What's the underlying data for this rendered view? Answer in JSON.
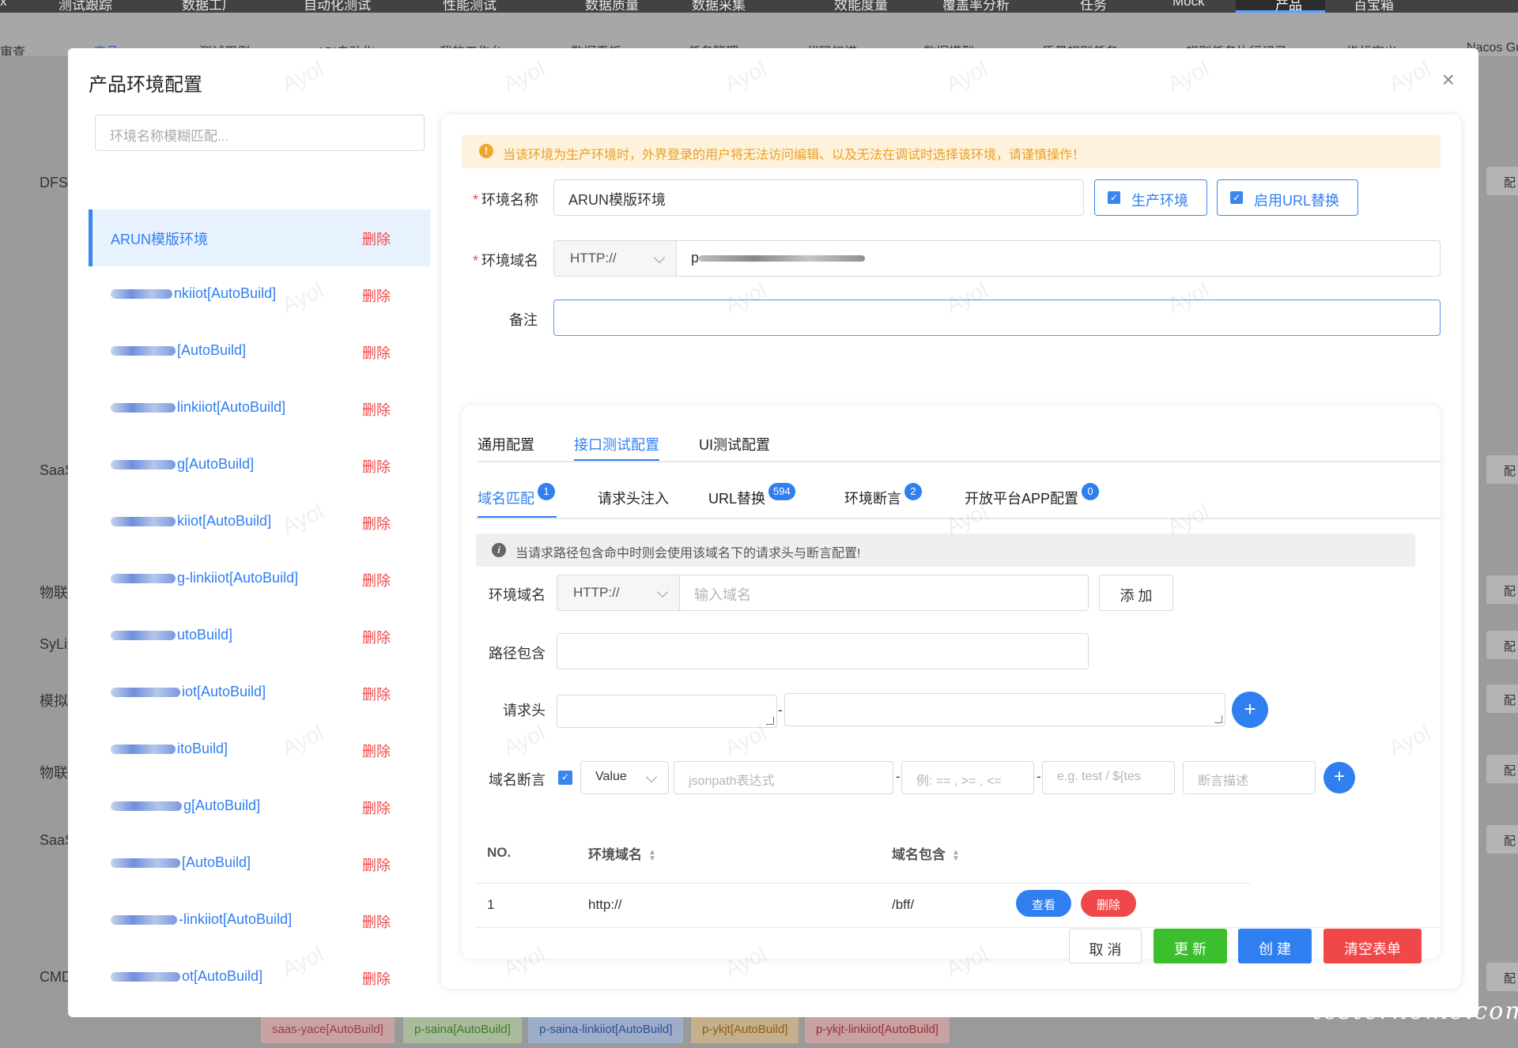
{
  "background": {
    "top_menu": [
      "测试跟踪",
      "数据工厂",
      "自动化测试",
      "性能测试",
      "数据质量",
      "数据采集",
      "效能度量",
      "覆盖率分析",
      "任务",
      "Mock",
      "产品",
      "百宝箱"
    ],
    "sub_tabs": [
      "审查",
      "产品",
      "测试用例",
      "API自动化",
      "我的工作台",
      "数据看板",
      "任务管理",
      "代码扫描",
      "数据模型",
      "质量规则任务",
      "规则任务执行记录",
      "指标定义",
      "Nacos Gu"
    ],
    "left_labels": [
      "DFS",
      "SaaS",
      "物联",
      "SyLi",
      "模拟",
      "物联",
      "SaaS",
      "CMD"
    ],
    "right_button_label": "配",
    "bottom_tags": [
      "saas-yace[AutoBuild]",
      "p-saina[AutoBuild]",
      "p-saina-linkiiot[AutoBuild]",
      "p-ykjt[AutoBuild]",
      "p-ykjt-linkiiot[AutoBuild]"
    ],
    "watermark_text": "Ayol",
    "corner_watermark": "testerhome.com"
  },
  "modal": {
    "title": "产品环境配置",
    "close_icon": "×",
    "search_placeholder": "环境名称模糊匹配...",
    "delete_label": "删除",
    "env_items": [
      {
        "name": "ARUN模版环境",
        "blur": 0
      },
      {
        "name": "nkiiot[AutoBuild]",
        "blur": 78
      },
      {
        "name": "[AutoBuild]",
        "blur": 82
      },
      {
        "name": "linkiiot[AutoBuild]",
        "blur": 82
      },
      {
        "name": "g[AutoBuild]",
        "blur": 82
      },
      {
        "name": "kiiot[AutoBuild]",
        "blur": 82
      },
      {
        "name": "g-linkiiot[AutoBuild]",
        "blur": 82
      },
      {
        "name": "utoBuild]",
        "blur": 82
      },
      {
        "name": "iot[AutoBuild]",
        "blur": 88
      },
      {
        "name": "itoBuild]",
        "blur": 82
      },
      {
        "name": "g[AutoBuild]",
        "blur": 90
      },
      {
        "name": "[AutoBuild]",
        "blur": 88
      },
      {
        "name": "-linkiiot[AutoBuild]",
        "blur": 84
      },
      {
        "name": "ot[AutoBuild]",
        "blur": 88
      }
    ]
  },
  "form": {
    "alert": "当该环境为生产环境时，外界登录的用户将无法访问编辑、以及无法在调试时选择该环境，请谨慎操作！",
    "alert_icon": "!",
    "env_name_label": "环境名称",
    "env_name_value": "ARUN模版环境",
    "prod_checkbox": "生产环境",
    "url_replace_checkbox": "启用URL替换",
    "domain_label": "环境域名",
    "protocol": "HTTP://",
    "domain_value": "p",
    "remark_label": "备注",
    "remark_value": ""
  },
  "config": {
    "tabs": [
      "通用配置",
      "接口测试配置",
      "UI测试配置"
    ],
    "active_tab": 1,
    "sub_tabs": [
      {
        "label": "域名匹配",
        "badge": "1"
      },
      {
        "label": "请求头注入",
        "badge": ""
      },
      {
        "label": "URL替换",
        "badge": "594"
      },
      {
        "label": "环境断言",
        "badge": "2"
      },
      {
        "label": "开放平台APP配置",
        "badge": "0"
      }
    ],
    "info": "当请求路径包含命中时则会使用该域名下的请求头与断言配置!",
    "info_icon": "i",
    "domain_label": "环境域名",
    "domain_protocol": "HTTP://",
    "domain_placeholder": "输入域名",
    "add_button": "添 加",
    "path_label": "路径包含",
    "header_label": "请求头",
    "assert_label": "域名断言",
    "assert_type": "Value",
    "jsonpath_placeholder": "jsonpath表达式",
    "operator_placeholder": "例: == , >= , <=",
    "expected_placeholder": "e.g. test / ${tes",
    "desc_placeholder": "断言描述",
    "dash": "-",
    "plus": "+",
    "table": {
      "headers": [
        "NO.",
        "环境域名",
        "域名包含"
      ],
      "rows": [
        {
          "no": "1",
          "domain": "http://",
          "contains": "/bff/"
        }
      ],
      "view_button": "查看",
      "delete_button": "删除"
    }
  },
  "footer": {
    "cancel": "取 消",
    "update": "更 新",
    "create": "创 建",
    "clear": "清空表单"
  },
  "colors": {
    "primary": "#2f7ff0",
    "danger": "#f04848",
    "success": "#3bbf2c",
    "warning": "#e8a021"
  }
}
